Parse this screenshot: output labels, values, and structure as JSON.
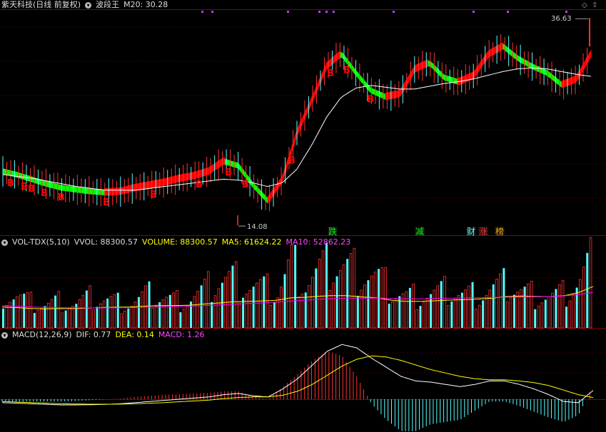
{
  "header": {
    "title": "紫天科技(日线 前复权)",
    "indicator": "波段王",
    "ma_label": "M20: 30.28",
    "expand_icon": "chevron-down-icon"
  },
  "vol_header": {
    "name": "VOL-TDX(5,10)",
    "vvol": "VVOL: 88300.57",
    "volume": "VOLUME: 88300.57",
    "ma5": "MA5: 61624.22",
    "ma10": "MA10: 52862.23"
  },
  "macd_header": {
    "name": "MACD(12,26,9)",
    "dif": "DIF: 0.77",
    "dea": "DEA: 0.14",
    "macd": "MACD: 1.26"
  },
  "annotations": {
    "high_label": "36.63",
    "low_label": "14.08",
    "buy_marker": "B",
    "event_labels": [
      "跌",
      "减",
      "财",
      "涨",
      "榜"
    ]
  },
  "colors": {
    "up": "#ff3232",
    "down": "#54ffff",
    "ma_white": "#ffffff",
    "ma5": "#ffff00",
    "ma10": "#ff00ff",
    "band_up": "#ff0000",
    "band_down": "#00ff00",
    "grid": "#8b0000"
  },
  "chart_data": [
    {
      "type": "line",
      "title": "紫天科技(日线 前复权)",
      "series": [
        {
          "name": "波段王",
          "values": [
            19.8,
            19.4,
            18.9,
            18.4,
            18.0,
            17.8,
            17.6,
            17.5,
            17.6,
            18.0,
            18.3,
            18.6,
            19.0,
            19.3,
            19.8,
            20.9,
            20.4,
            18.3,
            16.6,
            18.9,
            24.0,
            27.5,
            31.2,
            32.6,
            30.5,
            28.6,
            27.9,
            28.2,
            30.9,
            31.6,
            30.0,
            29.5,
            30.2,
            32.5,
            33.4,
            32.1,
            31.2,
            30.5,
            29.2,
            29.8,
            32.6
          ]
        },
        {
          "name": "M20",
          "values": [
            19.6,
            19.4,
            19.2,
            18.9,
            18.6,
            18.3,
            18.1,
            17.9,
            17.9,
            17.9,
            18.1,
            18.3,
            18.5,
            18.7,
            18.9,
            19.1,
            19.0,
            18.7,
            18.3,
            18.7,
            20.2,
            22.8,
            25.8,
            28.0,
            29.0,
            29.3,
            29.1,
            28.9,
            28.9,
            29.2,
            29.5,
            29.7,
            30.0,
            30.4,
            30.8,
            31.1,
            31.2,
            31.1,
            30.8,
            30.5,
            30.28
          ]
        }
      ],
      "ylim": [
        13,
        37.5
      ],
      "high": 36.63,
      "low": 14.08,
      "buy_points": [
        14,
        33,
        43,
        61,
        85,
        148,
        214,
        278,
        319,
        343,
        408,
        462,
        485,
        518
      ],
      "events": [
        "跌",
        "减",
        "财",
        "涨",
        "榜"
      ]
    },
    {
      "type": "bar",
      "title": "VOL-TDX(5,10)",
      "values": [
        42,
        38,
        30,
        28,
        33,
        29,
        36,
        35,
        31,
        30,
        40,
        37,
        33,
        36,
        45,
        58,
        60,
        52,
        48,
        42,
        80,
        55,
        70,
        76,
        72,
        68,
        60,
        44,
        38,
        40,
        42,
        45,
        40,
        41,
        48,
        52,
        44,
        40,
        38,
        41,
        55,
        88
      ],
      "series": [
        {
          "name": "MA5",
          "values": [
            31000,
            30200,
            28900,
            28400,
            28800,
            28700,
            29500,
            30300,
            30800,
            31100,
            32500,
            33200,
            33300,
            33800,
            35500,
            37100,
            38900,
            39400,
            40200,
            41000,
            44700,
            45500,
            47200,
            48100,
            47900,
            46000,
            44800,
            41200,
            39500,
            39600,
            40300,
            41400,
            42000,
            42800,
            44300,
            46700,
            47400,
            46800,
            46600,
            47900,
            52600,
            61624.22
          ]
        },
        {
          "name": "MA10",
          "values": [
            33000,
            32100,
            31200,
            30500,
            30100,
            29800,
            29700,
            29800,
            30000,
            30200,
            30800,
            31400,
            31800,
            32300,
            33200,
            34100,
            35100,
            36300,
            37200,
            38300,
            40100,
            41200,
            42600,
            43700,
            44300,
            44300,
            44500,
            43800,
            43300,
            43300,
            43800,
            44200,
            44600,
            44900,
            45100,
            45700,
            46100,
            46400,
            46600,
            47600,
            49600,
            52862.23
          ]
        }
      ],
      "current_volume": 88300.57
    },
    {
      "type": "line",
      "title": "MACD(12,26,9)",
      "x": [
        0,
        1,
        2,
        3,
        4,
        5,
        6,
        7,
        8,
        9,
        10,
        11,
        12,
        13,
        14,
        15,
        16,
        17,
        18,
        19,
        20,
        21,
        22,
        23,
        24,
        25,
        26,
        27,
        28,
        29,
        30,
        31,
        32,
        33,
        34,
        35,
        36,
        37,
        38,
        39,
        40
      ],
      "series": [
        {
          "name": "DIF",
          "values": [
            -0.3,
            -0.35,
            -0.4,
            -0.45,
            -0.5,
            -0.5,
            -0.48,
            -0.45,
            -0.4,
            -0.3,
            -0.2,
            -0.1,
            0.0,
            0.1,
            0.2,
            0.4,
            0.5,
            0.3,
            0.2,
            0.9,
            1.8,
            3.0,
            4.2,
            4.8,
            4.5,
            3.6,
            2.8,
            2.0,
            1.6,
            1.5,
            1.3,
            1.1,
            1.3,
            1.6,
            1.6,
            1.3,
            0.9,
            0.4,
            -0.2,
            -0.3,
            0.77
          ]
        },
        {
          "name": "DEA",
          "values": [
            -0.2,
            -0.25,
            -0.3,
            -0.35,
            -0.4,
            -0.42,
            -0.44,
            -0.44,
            -0.43,
            -0.4,
            -0.35,
            -0.3,
            -0.22,
            -0.15,
            -0.08,
            0.05,
            0.15,
            0.2,
            0.2,
            0.35,
            0.7,
            1.3,
            2.1,
            2.9,
            3.5,
            3.8,
            3.7,
            3.4,
            3.0,
            2.6,
            2.3,
            2.0,
            1.8,
            1.7,
            1.7,
            1.6,
            1.45,
            1.2,
            0.8,
            0.4,
            0.14
          ]
        }
      ],
      "histogram": [
        -0.2,
        -0.2,
        -0.2,
        -0.2,
        -0.2,
        -0.16,
        -0.08,
        -0.02,
        0.06,
        0.2,
        0.3,
        0.4,
        0.44,
        0.5,
        0.56,
        0.7,
        0.7,
        0.2,
        0.0,
        1.1,
        2.2,
        3.4,
        4.2,
        3.8,
        2.0,
        -0.4,
        -1.8,
        -2.8,
        -2.8,
        -2.2,
        -2.0,
        -1.8,
        -1.0,
        -0.2,
        -0.2,
        -0.6,
        -1.1,
        -1.6,
        -2.0,
        -1.4,
        1.26
      ]
    }
  ]
}
